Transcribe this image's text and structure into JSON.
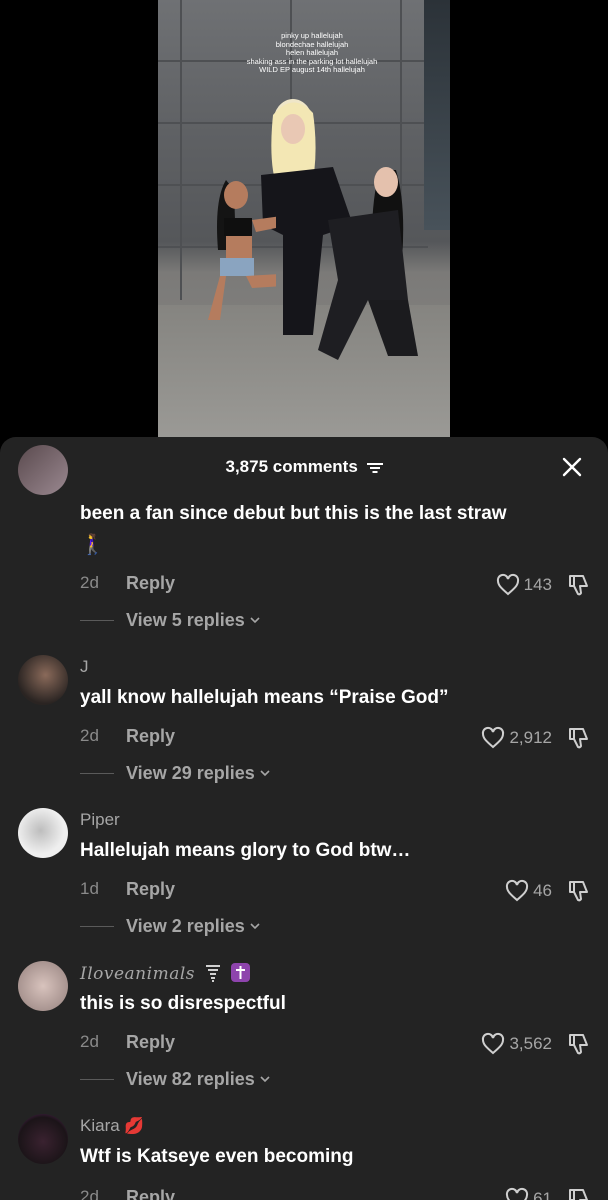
{
  "video": {
    "overlay_lines": [
      "pinky up hallelujah",
      "blondechae hallelujah",
      "helen hallelujah",
      "shaking ass in the parking lot hallelujah",
      "WILD EP august 14th hallelujah"
    ]
  },
  "sheet": {
    "comment_count": "3,875 comments",
    "sort_icon": "sort-lines-icon",
    "close_icon": "close-icon"
  },
  "comments": [
    {
      "username": "",
      "text": "been a fan since debut but this is the last straw",
      "emoji": "🚶‍♀️",
      "time": "2d",
      "reply_label": "Reply",
      "likes": "143",
      "view_replies": "View 5 replies"
    },
    {
      "username": "J",
      "text": "yall know hallelujah means “Praise God”",
      "time": "2d",
      "reply_label": "Reply",
      "likes": "2,912",
      "view_replies": "View 29 replies"
    },
    {
      "username": "Piper",
      "text": "Hallelujah means glory to God btw…",
      "time": "1d",
      "reply_label": "Reply",
      "likes": "46",
      "view_replies": "View 2 replies"
    },
    {
      "username": "Iloveanimals",
      "text": "this is so disrespectful",
      "time": "2d",
      "reply_label": "Reply",
      "likes": "3,562",
      "view_replies": "View 82 replies"
    },
    {
      "username": "Kiara",
      "username_emoji": "💋",
      "text": "Wtf is Katseye even becoming",
      "time": "2d",
      "reply_label": "Reply",
      "likes": "61"
    }
  ],
  "colors": {
    "sheet_bg": "#232323",
    "primary_text": "#ffffff",
    "secondary_text": "#a6a6a6",
    "badge_purple": "#8e44ad"
  }
}
